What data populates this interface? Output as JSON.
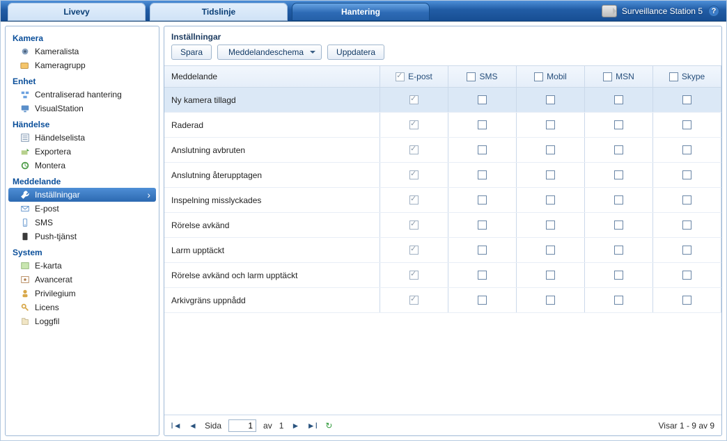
{
  "header": {
    "title": "Surveillance Station 5",
    "tabs": [
      "Livevy",
      "Tidslinje",
      "Hantering"
    ],
    "active_tab": "Hantering"
  },
  "sidebar": {
    "sections": [
      {
        "title": "Kamera",
        "items": [
          "Kameralista",
          "Kameragrupp"
        ]
      },
      {
        "title": "Enhet",
        "items": [
          "Centraliserad hantering",
          "VisualStation"
        ]
      },
      {
        "title": "Händelse",
        "items": [
          "Händelselista",
          "Exportera",
          "Montera"
        ]
      },
      {
        "title": "Meddelande",
        "items": [
          "Inställningar",
          "E-post",
          "SMS",
          "Push-tjänst"
        ],
        "selected": "Inställningar"
      },
      {
        "title": "System",
        "items": [
          "E-karta",
          "Avancerat",
          "Privilegium",
          "Licens",
          "Loggfil"
        ]
      }
    ]
  },
  "panel": {
    "title": "Inställningar",
    "buttons": {
      "save": "Spara",
      "schedule": "Meddelandeschema",
      "refresh": "Uppdatera"
    }
  },
  "grid": {
    "columns": [
      "Meddelande",
      "E-post",
      "SMS",
      "Mobil",
      "MSN",
      "Skype"
    ],
    "header_checks": [
      null,
      true,
      false,
      false,
      false,
      false
    ],
    "rows": [
      {
        "label": "Ny kamera tillagd",
        "v": [
          true,
          false,
          false,
          false,
          false
        ],
        "selected": true
      },
      {
        "label": "Raderad",
        "v": [
          true,
          false,
          false,
          false,
          false
        ]
      },
      {
        "label": "Anslutning avbruten",
        "v": [
          true,
          false,
          false,
          false,
          false
        ]
      },
      {
        "label": "Anslutning återupptagen",
        "v": [
          true,
          false,
          false,
          false,
          false
        ]
      },
      {
        "label": "Inspelning misslyckades",
        "v": [
          true,
          false,
          false,
          false,
          false
        ]
      },
      {
        "label": "Rörelse avkänd",
        "v": [
          true,
          false,
          false,
          false,
          false
        ]
      },
      {
        "label": "Larm upptäckt",
        "v": [
          true,
          false,
          false,
          false,
          false
        ]
      },
      {
        "label": "Rörelse avkänd och larm upptäckt",
        "v": [
          true,
          false,
          false,
          false,
          false
        ]
      },
      {
        "label": "Arkivgräns uppnådd",
        "v": [
          true,
          false,
          false,
          false,
          false
        ]
      }
    ]
  },
  "pager": {
    "side_label": "Sida",
    "page": "1",
    "of_label": "av",
    "total_pages": "1",
    "summary": "Visar 1 - 9 av 9"
  }
}
